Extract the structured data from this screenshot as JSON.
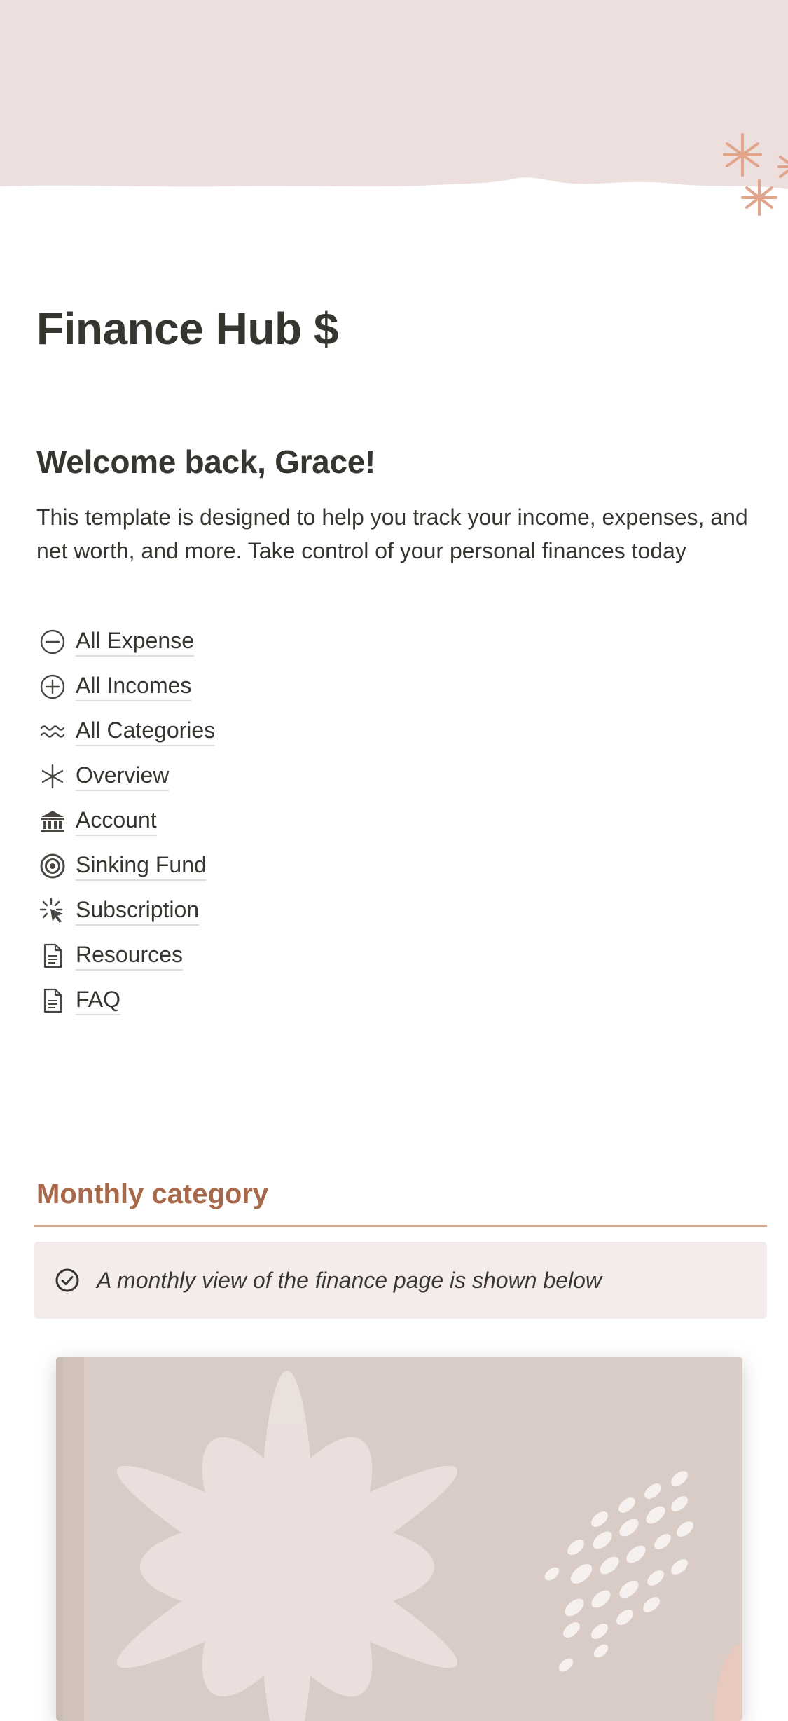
{
  "page": {
    "title": "Finance Hub $"
  },
  "welcome": {
    "heading": "Welcome back, Grace!",
    "intro": "This template is designed to help you track your income, expenses, and net worth, and more. Take control of your personal finances today"
  },
  "links": [
    {
      "label": "All Expense",
      "icon": "minus-circle-icon"
    },
    {
      "label": "All Incomes",
      "icon": "plus-circle-icon"
    },
    {
      "label": "All Categories",
      "icon": "wave-icon"
    },
    {
      "label": "Overview",
      "icon": "asterisk-icon"
    },
    {
      "label": "Account",
      "icon": "bank-icon"
    },
    {
      "label": "Sinking Fund",
      "icon": "target-icon"
    },
    {
      "label": "Subscription",
      "icon": "click-burst-icon"
    },
    {
      "label": "Resources",
      "icon": "document-icon"
    },
    {
      "label": "FAQ",
      "icon": "document-icon"
    }
  ],
  "monthly": {
    "heading": "Monthly category",
    "callout": "A monthly view of the finance page is shown below",
    "callout_icon": "check-circle-icon"
  },
  "colors": {
    "cover_bg": "#ecdfdd",
    "accent": "#a8684a",
    "sparkle": "#e0a58a",
    "callout_bg": "#f3eceb",
    "image_bg": "#d9ccc6"
  }
}
